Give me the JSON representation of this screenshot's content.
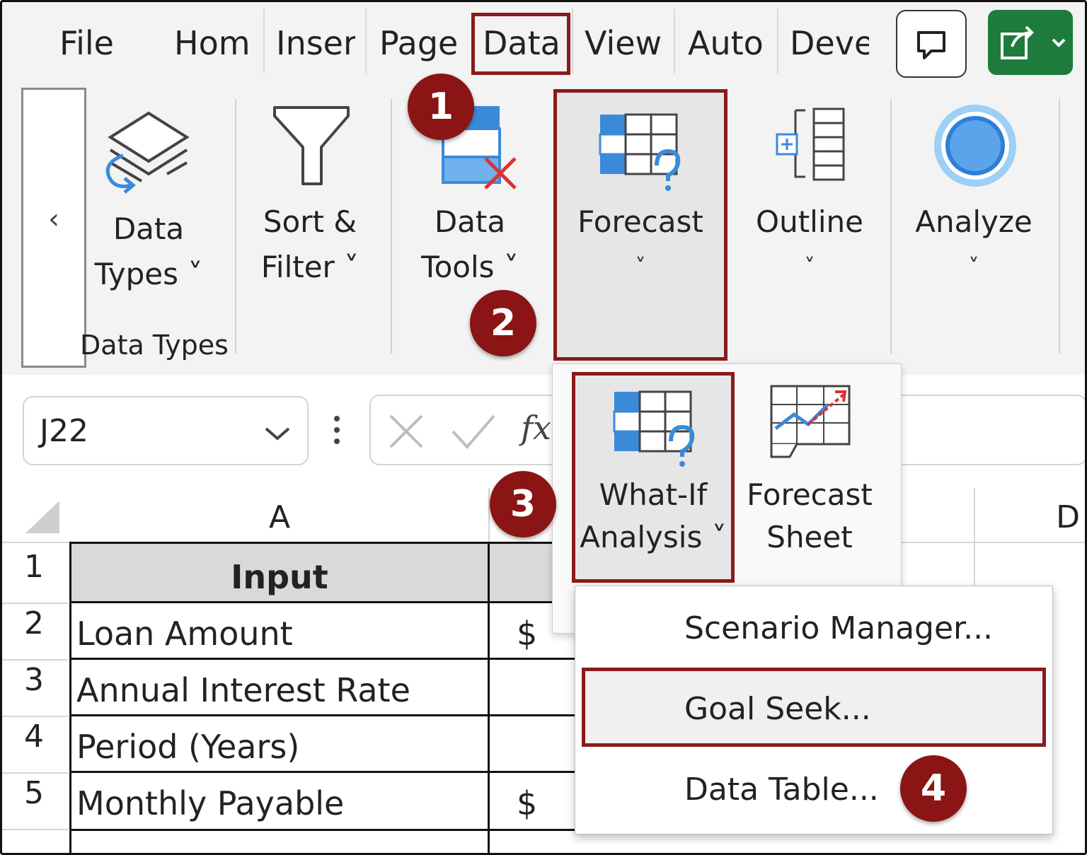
{
  "tabs": [
    {
      "label": "File"
    },
    {
      "label": "Hom"
    },
    {
      "label": "Inser"
    },
    {
      "label": "Page"
    },
    {
      "label": "Data"
    },
    {
      "label": "View"
    },
    {
      "label": "Auto"
    },
    {
      "label": "Deve"
    }
  ],
  "ribbon": {
    "scroll_left": "‹",
    "data_types": {
      "line1": "Data",
      "line2": "Types ˅",
      "group_label": "Data Types"
    },
    "sort_filter": {
      "line1": "Sort &",
      "line2": "Filter ˅"
    },
    "data_tools": {
      "line1": "Data",
      "line2": "Tools ˅"
    },
    "forecast": {
      "line1": "Forecast",
      "chev": "˅"
    },
    "outline": {
      "line1": "Outline",
      "chev": "˅"
    },
    "analyze": {
      "line1": "Analyze",
      "chev": "˅"
    }
  },
  "forecast_panel": {
    "what_if": {
      "line1": "What-If",
      "line2": "Analysis ˅"
    },
    "forecast_sheet": {
      "line1": "Forecast",
      "line2": "Sheet"
    }
  },
  "whatif_menu": {
    "scenario_manager": "Scenario Manager...",
    "goal_seek": "Goal Seek...",
    "data_table": "Data Table..."
  },
  "formula_bar": {
    "name_box": "J22",
    "fx": "fx"
  },
  "sheet": {
    "columns": [
      "A",
      "D"
    ],
    "rows": [
      {
        "num": "1",
        "a": "Input",
        "b": ""
      },
      {
        "num": "2",
        "a": "Loan Amount",
        "b": "$"
      },
      {
        "num": "3",
        "a": "Annual Interest Rate",
        "b": ""
      },
      {
        "num": "4",
        "a": "Period (Years)",
        "b": ""
      },
      {
        "num": "5",
        "a": "Monthly Payable",
        "b": "$"
      }
    ]
  },
  "steps": [
    "1",
    "2",
    "3",
    "4"
  ],
  "colors": {
    "highlight": "#8b1a1a",
    "badge": "#8b1414",
    "share_button": "#1e7b3c",
    "icon_blue": "#3b8ad9"
  }
}
